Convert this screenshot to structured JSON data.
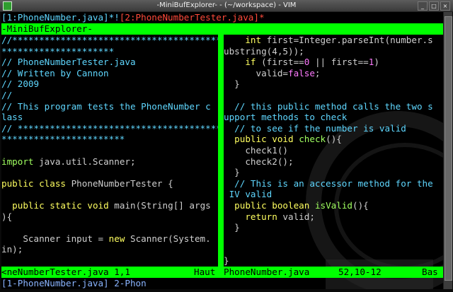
{
  "window": {
    "title": "-MiniBufExplorer- - (~/workspace) - VIM",
    "buttons": [
      "_",
      "□",
      "×"
    ]
  },
  "buffers": {
    "b1": "[1:PhoneNumber.java]*!",
    "b2": "[2:PhoneNumberTester.java]*"
  },
  "minibuf_title": "-MiniBufExplorer-",
  "left_pane": [
    [
      [
        "cm",
        "//**********************************************"
      ]
    ],
    [
      [
        "cm",
        "*********************"
      ]
    ],
    [
      [
        "cm",
        "// PhoneNumberTester.java"
      ]
    ],
    [
      [
        "cm",
        "// Written by Cannon"
      ]
    ],
    [
      [
        "cm",
        "// 2009"
      ]
    ],
    [
      [
        "cm",
        "//"
      ]
    ],
    [
      [
        "cm",
        "// This program tests the PhoneNumber c"
      ]
    ],
    [
      [
        "cm",
        "lass"
      ]
    ],
    [
      [
        "cm",
        "// *********************************************"
      ]
    ],
    [
      [
        "cm",
        "***********************"
      ]
    ],
    [
      [
        "tx",
        ""
      ]
    ],
    [
      [
        "ty",
        "import"
      ],
      [
        "tx",
        " java.util.Scanner;"
      ]
    ],
    [
      [
        "tx",
        ""
      ]
    ],
    [
      [
        "kw",
        "public"
      ],
      [
        "tx",
        " "
      ],
      [
        "kw",
        "class"
      ],
      [
        "tx",
        " PhoneNumberTester {"
      ]
    ],
    [
      [
        "tx",
        ""
      ]
    ],
    [
      [
        "tx",
        "  "
      ],
      [
        "kw",
        "public"
      ],
      [
        "tx",
        " "
      ],
      [
        "kw",
        "static"
      ],
      [
        "tx",
        " "
      ],
      [
        "kw",
        "void"
      ],
      [
        "tx",
        " main(String[] args"
      ]
    ],
    [
      [
        "tx",
        "){"
      ]
    ],
    [
      [
        "tx",
        ""
      ]
    ],
    [
      [
        "tx",
        "    Scanner input = "
      ],
      [
        "kw",
        "new"
      ],
      [
        "tx",
        " Scanner(System."
      ]
    ],
    [
      [
        "tx",
        "in);"
      ]
    ],
    [
      [
        "tx",
        ""
      ]
    ]
  ],
  "right_pane": [
    [
      [
        "tx",
        "    "
      ],
      [
        "kw",
        "int"
      ],
      [
        "tx",
        " first=Integer.parseInt(number.s"
      ]
    ],
    [
      [
        "tx",
        "ubstring(4,5));"
      ]
    ],
    [
      [
        "tx",
        "    "
      ],
      [
        "kw",
        "if"
      ],
      [
        "tx",
        " (first=="
      ],
      [
        "nm",
        "0"
      ],
      [
        "tx",
        " || first=="
      ],
      [
        "nm",
        "1"
      ],
      [
        "tx",
        ")"
      ]
    ],
    [
      [
        "tx",
        "      valid="
      ],
      [
        "nm",
        "false"
      ],
      [
        "tx",
        ";"
      ]
    ],
    [
      [
        "tx",
        "  }"
      ]
    ],
    [
      [
        "tx",
        ""
      ]
    ],
    [
      [
        "cm",
        "  // this public method calls the two s"
      ]
    ],
    [
      [
        "cm",
        "upport methods to check"
      ]
    ],
    [
      [
        "cm",
        "  // to see if the number is valid"
      ]
    ],
    [
      [
        "tx",
        "  "
      ],
      [
        "kw",
        "public"
      ],
      [
        "tx",
        " "
      ],
      [
        "kw",
        "void"
      ],
      [
        "tx",
        " "
      ],
      [
        "fn",
        "check"
      ],
      [
        "tx",
        "(){"
      ]
    ],
    [
      [
        "tx",
        "    check1()"
      ]
    ],
    [
      [
        "tx",
        "    check2();"
      ]
    ],
    [
      [
        "tx",
        "  }"
      ]
    ],
    [
      [
        "cm",
        "  // This is an accessor method for the"
      ]
    ],
    [
      [
        "cm",
        " IV valid"
      ]
    ],
    [
      [
        "tx",
        "  "
      ],
      [
        "kw",
        "public"
      ],
      [
        "tx",
        " "
      ],
      [
        "kw",
        "boolean"
      ],
      [
        "tx",
        " "
      ],
      [
        "fn",
        "isValid"
      ],
      [
        "tx",
        "(){"
      ]
    ],
    [
      [
        "tx",
        "    "
      ],
      [
        "kw",
        "return"
      ],
      [
        "tx",
        " valid;"
      ]
    ],
    [
      [
        "tx",
        "  }"
      ]
    ],
    [
      [
        "tx",
        ""
      ]
    ],
    [
      [
        "tx",
        ""
      ]
    ],
    [
      [
        "tx",
        "}"
      ]
    ]
  ],
  "status": {
    "left_file": "<neNumberTester.java 1,1",
    "left_pos": "Haut",
    "right_file": "PhoneNumber.java",
    "right_pos": "52,10-12",
    "right_pct": "Bas"
  },
  "cmdline": "[1-PhoneNumber.java] 2-Phon"
}
